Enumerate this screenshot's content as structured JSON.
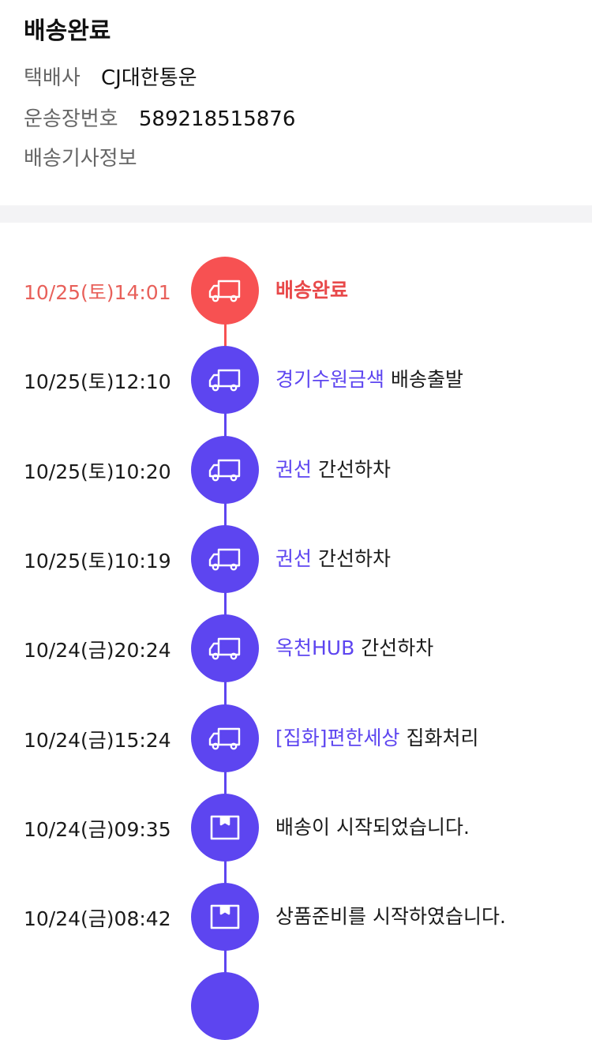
{
  "header": {
    "status_title": "배송완료",
    "courier_label": "택배사",
    "courier_value": "CJ대한통운",
    "tracking_label": "운송장번호",
    "tracking_value": "589218515876",
    "driver_info_label": "배송기사정보"
  },
  "colors": {
    "accent": "#5d45f0",
    "done": "#f75152",
    "done_text": "#e8605a",
    "divider": "#f3f3f5"
  },
  "events": [
    {
      "time": "10/25(토)14:01",
      "location": "",
      "status": "배송완료",
      "icon": "truck-icon"
    },
    {
      "time": "10/25(토)12:10",
      "location": "경기수원금색",
      "status": "배송출발",
      "icon": "truck-icon"
    },
    {
      "time": "10/25(토)10:20",
      "location": "권선",
      "status": "간선하차",
      "icon": "truck-icon"
    },
    {
      "time": "10/25(토)10:19",
      "location": "권선",
      "status": "간선하차",
      "icon": "truck-icon"
    },
    {
      "time": "10/24(금)20:24",
      "location": "옥천HUB",
      "status": "간선하차",
      "icon": "truck-icon"
    },
    {
      "time": "10/24(금)15:24",
      "location": "[집화]편한세상",
      "status": "집화처리",
      "icon": "truck-icon"
    },
    {
      "time": "10/24(금)09:35",
      "location": "",
      "status": "배송이 시작되었습니다.",
      "icon": "box-icon"
    },
    {
      "time": "10/24(금)08:42",
      "location": "",
      "status": "상품준비를 시작하였습니다.",
      "icon": "box-icon"
    }
  ]
}
